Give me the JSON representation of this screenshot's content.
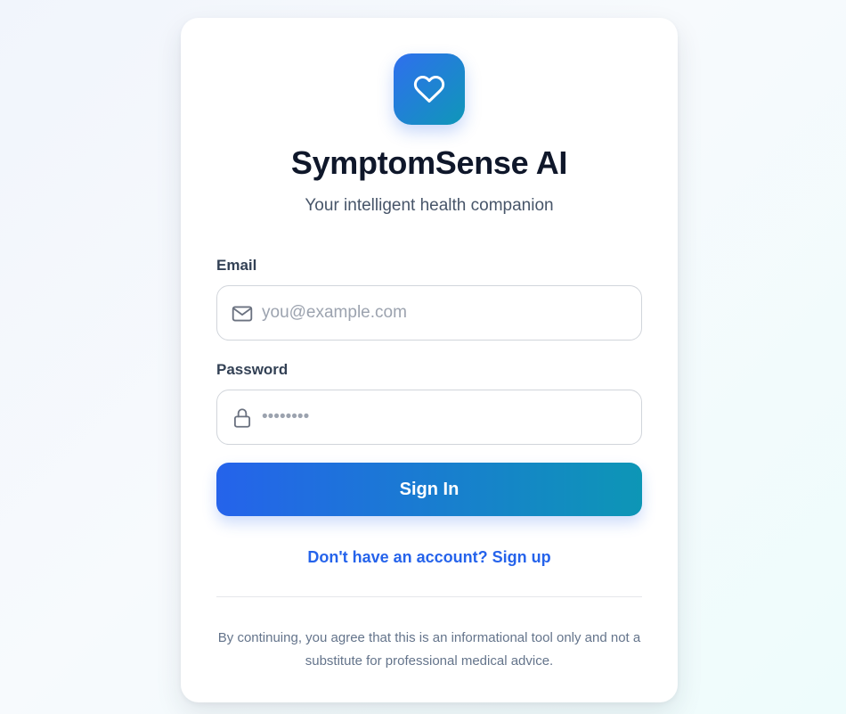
{
  "app": {
    "title": "SymptomSense AI",
    "subtitle": "Your intelligent health companion",
    "logo_icon": "heart-icon"
  },
  "form": {
    "email": {
      "label": "Email",
      "placeholder": "you@example.com",
      "value": "",
      "icon": "mail-icon"
    },
    "password": {
      "label": "Password",
      "placeholder": "••••••••",
      "value": "",
      "icon": "lock-icon"
    },
    "submit_label": "Sign In"
  },
  "signup_link": "Don't have an account? Sign up",
  "disclaimer": "By continuing, you agree that this is an informational tool only and not a substitute for professional medical advice.",
  "colors": {
    "accent_blue": "#2563eb",
    "accent_teal": "#0d96b6",
    "title": "#0f172a",
    "muted": "#64748b"
  }
}
